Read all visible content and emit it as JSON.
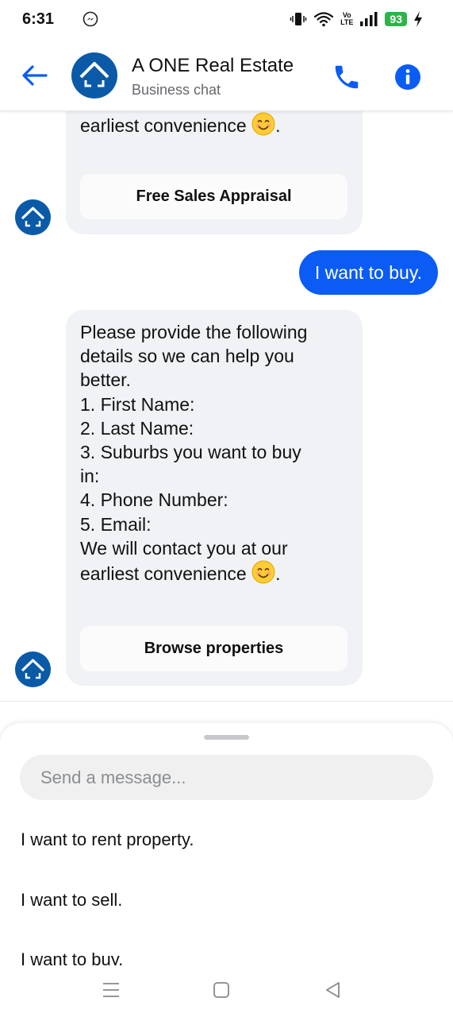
{
  "status_bar": {
    "time": "6:31",
    "battery": "93",
    "volte_top": "Vo",
    "volte_bottom": "LTE"
  },
  "header": {
    "title": "A ONE Real Estate",
    "subtitle": "Business chat"
  },
  "messages": {
    "bot_message_1": {
      "visible_tail": "earliest convenience",
      "tail_suffix": ".",
      "quick_reply": "Free Sales Appraisal"
    },
    "user_message": "I want to buy.",
    "bot_message_2": {
      "lines": [
        "Please provide the following",
        "details so we can help you",
        "better.",
        "1. First Name:",
        "2. Last Name:",
        "3. Suburbs you want to buy",
        "in:",
        "4. Phone Number:",
        "5. Email:",
        "We will contact you at our"
      ],
      "last_line": "earliest convenience",
      "last_suffix": ".",
      "quick_reply": "Browse properties"
    }
  },
  "composer": {
    "placeholder": "Send a message...",
    "suggestions": [
      "I want to rent property.",
      "I want to sell.",
      "I want to buy."
    ]
  },
  "colors": {
    "accent": "#0a5cf5",
    "brand": "#0b5aa8",
    "bubble": "#f0f2f5",
    "battery": "#2cb34a"
  },
  "icons": [
    "messenger-icon",
    "back-arrow-icon",
    "phone-icon",
    "info-icon",
    "smiling-face-emoji",
    "menu-icon",
    "home-icon",
    "back-icon"
  ]
}
